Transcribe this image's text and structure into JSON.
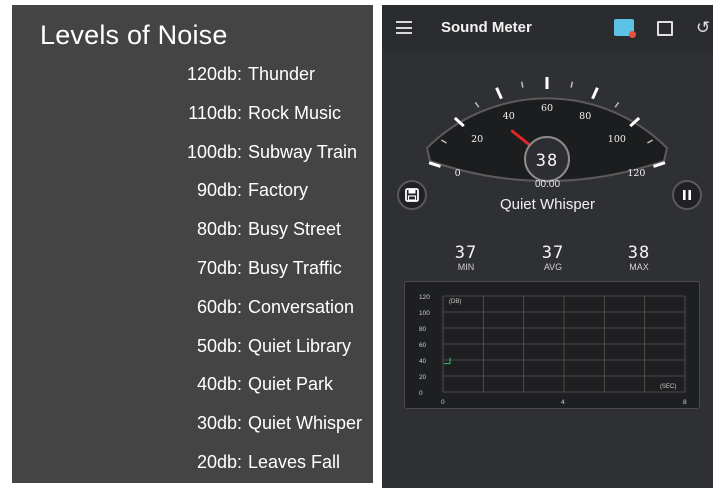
{
  "left": {
    "title": "Levels of Noise",
    "items": [
      {
        "level": "120db:",
        "source": "Thunder"
      },
      {
        "level": "110db:",
        "source": "Rock Music"
      },
      {
        "level": "100db:",
        "source": "Subway Train"
      },
      {
        "level": "90db:",
        "source": "Factory"
      },
      {
        "level": "80db:",
        "source": "Busy Street"
      },
      {
        "level": "70db:",
        "source": "Busy Traffic"
      },
      {
        "level": "60db:",
        "source": "Conversation"
      },
      {
        "level": "50db:",
        "source": "Quiet Library"
      },
      {
        "level": "40db:",
        "source": "Quiet Park"
      },
      {
        "level": "30db:",
        "source": "Quiet Whisper"
      },
      {
        "level": "20db:",
        "source": "Leaves Fall"
      }
    ]
  },
  "app": {
    "title": "Sound Meter",
    "icons": [
      "menu-icon",
      "theme-icon",
      "image-icon",
      "refresh-icon"
    ]
  },
  "gauge": {
    "ticks": [
      "0",
      "20",
      "40",
      "60",
      "80",
      "100",
      "120"
    ],
    "reading": "38",
    "needle_value": 38,
    "max": 120
  },
  "status": {
    "timer": "00:00",
    "level_name": "Quiet Whisper"
  },
  "stats": {
    "min_value": "37",
    "min_label": "MIN",
    "avg_value": "37",
    "avg_label": "AVG",
    "max_value": "38",
    "max_label": "MAX"
  },
  "graph": {
    "y_ticks": [
      "120",
      "100",
      "80",
      "60",
      "40",
      "20",
      "0"
    ],
    "x_ticks": [
      "0",
      "4",
      "8"
    ],
    "y_unit": "(DB)",
    "x_unit": "(SEC)",
    "trace_value": 38,
    "trace_color": "#3fbf6a"
  }
}
